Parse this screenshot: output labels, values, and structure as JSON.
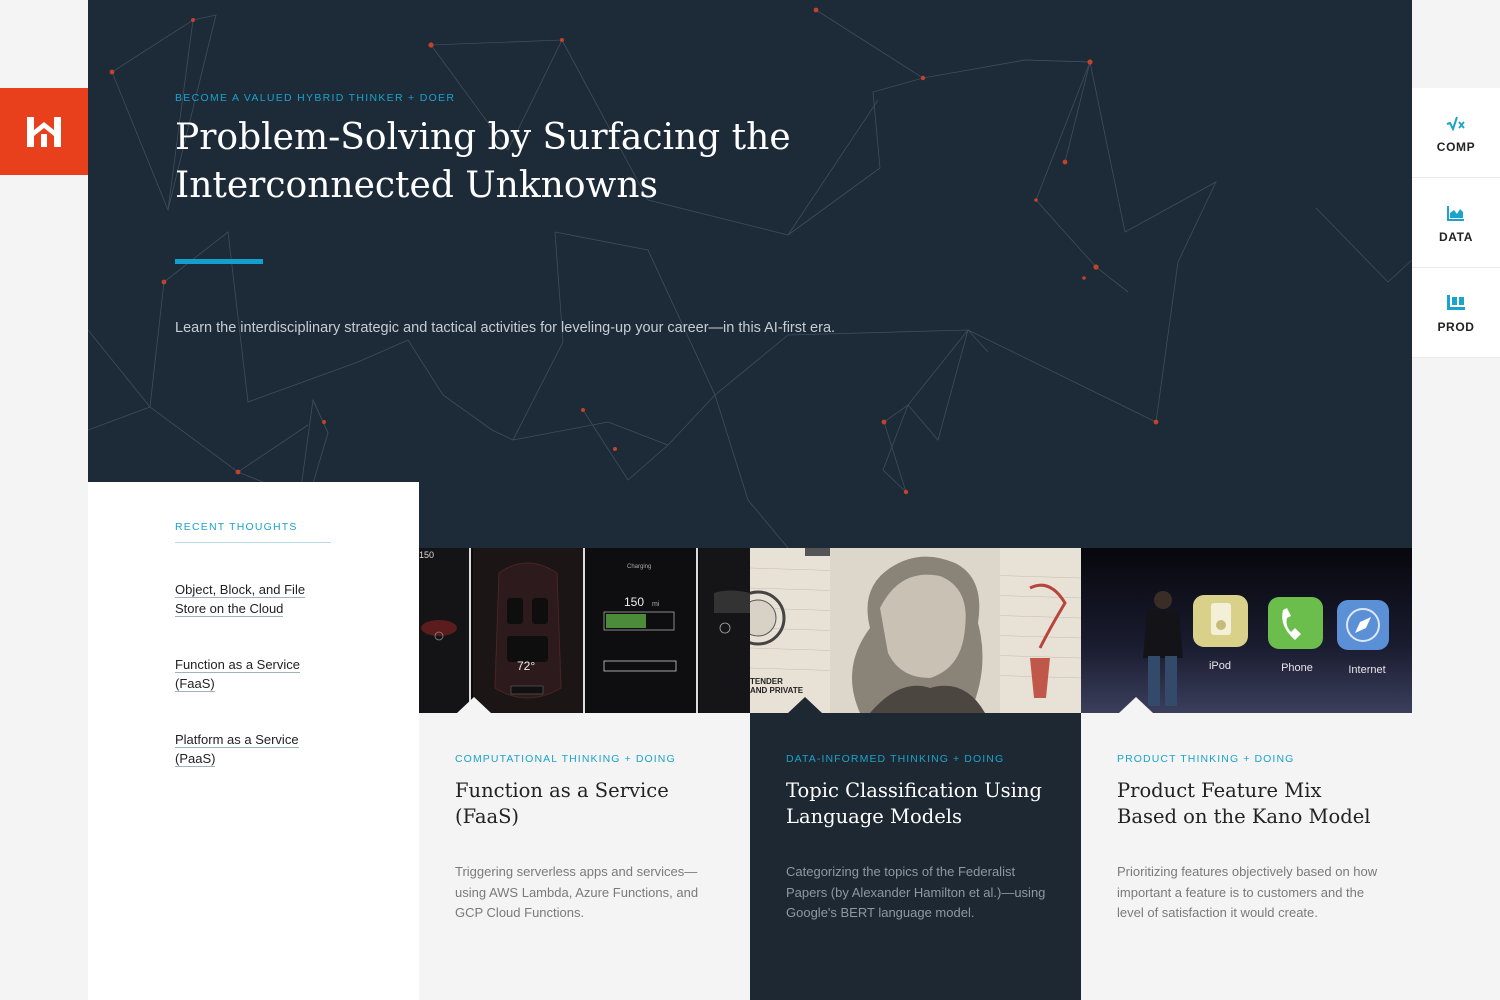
{
  "hero": {
    "eyebrow": "BECOME A VALUED HYBRID THINKER + DOER",
    "title": "Problem-Solving by Surfacing the Interconnected Unknowns",
    "description": "Learn the interdisciplinary strategic and tactical activities for leveling-up your career—in this AI-first era."
  },
  "sidenav": {
    "items": [
      {
        "label": "COMP",
        "icon": "square-root-icon"
      },
      {
        "label": "DATA",
        "icon": "area-chart-icon"
      },
      {
        "label": "PROD",
        "icon": "product-box-icon"
      }
    ]
  },
  "recent": {
    "heading": "RECENT THOUGHTS",
    "items": [
      {
        "label": "Object, Block, and File Store on the Cloud"
      },
      {
        "label": "Function as a Service (FaaS)"
      },
      {
        "label": "Platform as a Service (PaaS)"
      }
    ]
  },
  "cards": [
    {
      "category": "COMPUTATIONAL THINKING + DOING",
      "title": "Function as a Service (FaaS)",
      "description": "Triggering serverless apps and services—using AWS Lambda, Azure Functions, and GCP Cloud Functions.",
      "thumb": {
        "readouts": [
          "150",
          "mi",
          "72°",
          "150",
          "mi",
          "Charging"
        ]
      }
    },
    {
      "category": "DATA-INFORMED THINKING + DOING",
      "title": "Topic Classification Using Language Models",
      "description": "Categorizing the topics of the Federalist Papers (by Alexander Hamilton et al.)—using Google's BERT language model.",
      "thumb": {
        "readouts": [
          "TENDER",
          "AND PRIVATE"
        ]
      }
    },
    {
      "category": "PRODUCT THINKING + DOING",
      "title": "Product Feature Mix Based on the Kano Model",
      "description": "Prioritizing features objectively based on how important a feature is to customers and the level of satisfaction it would create.",
      "thumb": {
        "apps": [
          "iPod",
          "Phone",
          "Internet"
        ]
      }
    }
  ],
  "colors": {
    "brand": "#e8401c",
    "accent": "#1aa3cc",
    "hero_bg": "#1d2a38",
    "dark_card": "#1e2832"
  }
}
